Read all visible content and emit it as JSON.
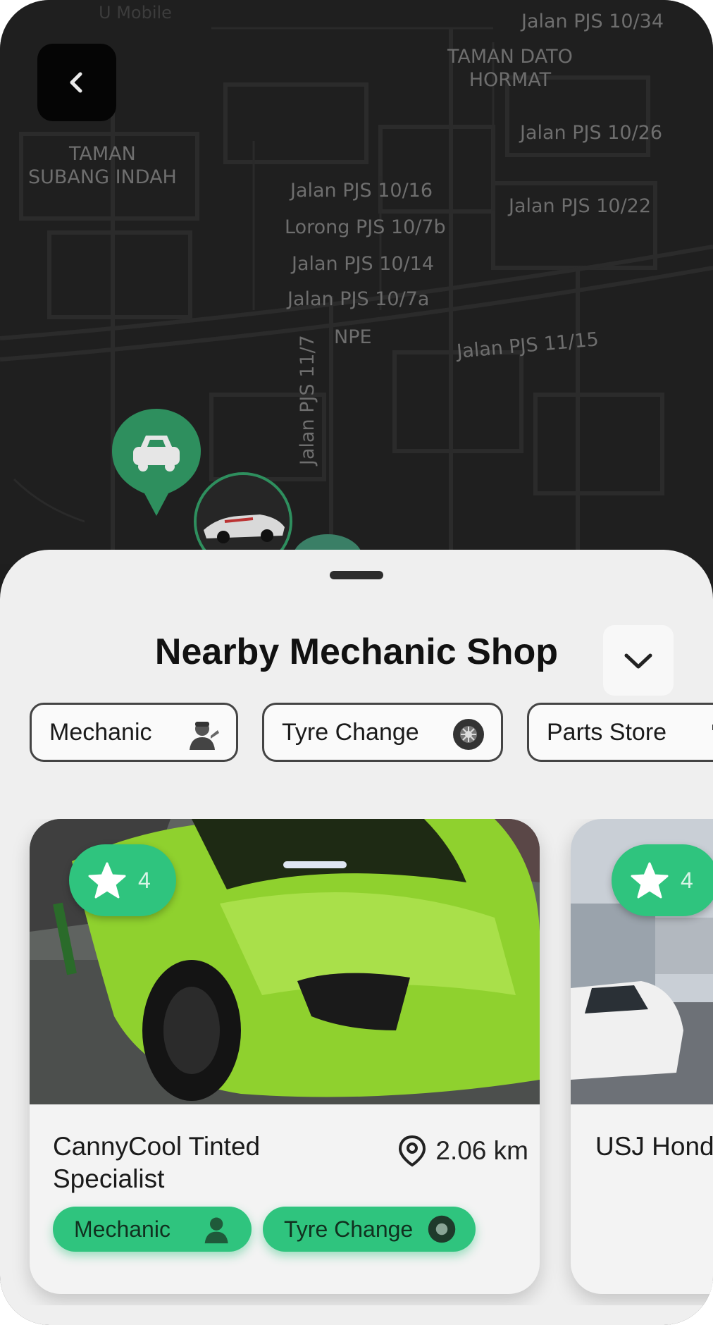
{
  "status_bar": {
    "carrier": "U Mobile"
  },
  "map": {
    "labels": [
      "Jalan PJS 10/34",
      "TAMAN DATO\nHORMAT",
      "TAMAN\nSUBANG INDAH",
      "Jalan PJS 10/26",
      "Jalan PJS 10/16",
      "Jalan PJS 10/22",
      "Lorong PJS 10/7b",
      "Jalan PJS 10/14",
      "Jalan PJS 10/7a",
      "NPE",
      "Jalan PJS 11/15",
      "Jalan PJS 11/7"
    ],
    "marker_icon": "car-icon"
  },
  "sheet": {
    "title": "Nearby Mechanic Shop",
    "collapse_icon": "chevron-down-icon",
    "filters": [
      {
        "label": "Mechanic",
        "icon": "mechanic-icon"
      },
      {
        "label": "Tyre Change",
        "icon": "tyre-icon"
      },
      {
        "label": "Parts Store",
        "icon": "parts-store-icon"
      }
    ],
    "shops": [
      {
        "rating": "4",
        "name": "CannyCool Tinted Specialist",
        "distance": "2.06 km",
        "tags": [
          "Mechanic",
          "Tyre Change"
        ]
      },
      {
        "rating": "4",
        "name": "USJ Honda (HQ)",
        "distance": "",
        "tags": []
      }
    ]
  },
  "colors": {
    "accent": "#2fc47e",
    "map_bg": "#1f1f1f",
    "sheet_bg": "#efefef"
  }
}
